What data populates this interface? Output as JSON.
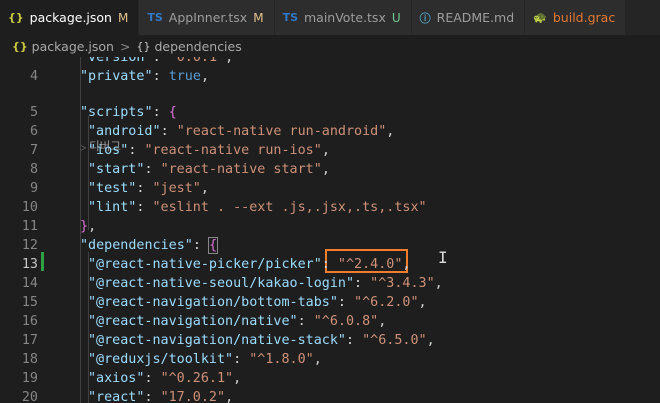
{
  "tabs": [
    {
      "icon": "{}",
      "label": "package.json",
      "status": "M",
      "active": true,
      "color": "#cbcb41",
      "status_color": "#e2c08d"
    },
    {
      "icon": "TS",
      "label": "AppInner.tsx",
      "status": "M",
      "active": false,
      "color": "#3178c6",
      "status_color": "#e2c08d"
    },
    {
      "icon": "TS",
      "label": "mainVote.tsx",
      "status": "U",
      "active": false,
      "color": "#3178c6",
      "status_color": "#73c991"
    },
    {
      "icon": "ⓘ",
      "label": "README.md",
      "status": "",
      "active": false,
      "color": "#519aba",
      "status_color": ""
    },
    {
      "icon": "🐢",
      "label": "build.grac",
      "status": "",
      "active": false,
      "color": "#e37933",
      "status_color": ""
    }
  ],
  "breadcrumb": {
    "file_icon": "{}",
    "file": "package.json",
    "separator": ">",
    "symbol_icon": "{}",
    "symbol": "dependencies"
  },
  "code_lens": "디버그",
  "lines": [
    {
      "n": "4",
      "text": "\"private\": true,"
    },
    {
      "n": "5",
      "text": "\"scripts\": {"
    },
    {
      "n": "6",
      "text": "\"android\": \"react-native run-android\","
    },
    {
      "n": "7",
      "text": "\"ios\": \"react-native run-ios\","
    },
    {
      "n": "8",
      "text": "\"start\": \"react-native start\","
    },
    {
      "n": "9",
      "text": "\"test\": \"jest\","
    },
    {
      "n": "10",
      "text": "\"lint\": \"eslint . --ext .js,.jsx,.ts,.tsx\""
    },
    {
      "n": "11",
      "text": "},"
    },
    {
      "n": "12",
      "text": "\"dependencies\": {"
    },
    {
      "n": "13",
      "text": "\"@react-native-picker/picker\": \"^2.4.0\","
    },
    {
      "n": "14",
      "text": "\"@react-native-seoul/kakao-login\": \"^3.4.3\","
    },
    {
      "n": "15",
      "text": "\"@react-navigation/bottom-tabs\": \"^6.2.0\","
    },
    {
      "n": "16",
      "text": "\"@react-navigation/native\": \"^6.0.8\","
    },
    {
      "n": "17",
      "text": "\"@react-navigation/native-stack\": \"^6.5.0\","
    },
    {
      "n": "18",
      "text": "\"@reduxjs/toolkit\": \"^1.8.0\","
    },
    {
      "n": "19",
      "text": "\"axios\": \"^0.26.1\","
    },
    {
      "n": "20",
      "text": "\"react\": \"17.0.2\","
    }
  ],
  "colors": {
    "editor_bg": "#1e1e1e",
    "key": "#9cdcfe",
    "string": "#ce9178",
    "keyword": "#569cd6",
    "highlight_box": "#f07c2c",
    "git_added": "#2ea043"
  }
}
